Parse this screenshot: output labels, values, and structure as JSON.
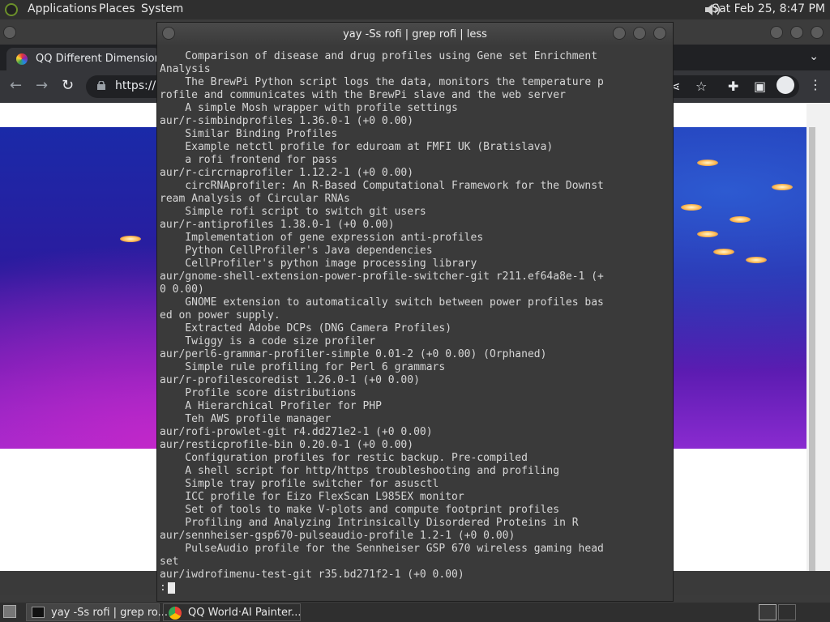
{
  "topbar": {
    "menus": [
      "Applications",
      "Places",
      "System"
    ],
    "clock": "Sat Feb 25,  8:47 PM"
  },
  "browser": {
    "tab_title": "QQ Different Dimension M",
    "url": "https://",
    "nav": {
      "back": "←",
      "forward": "→",
      "reload": "↻"
    },
    "icons": {
      "share": "⋖",
      "star": "☆",
      "extensions": "✚",
      "sidebar": "▣",
      "menu": "⋮",
      "tabs_dropdown": "⌄"
    }
  },
  "terminal": {
    "title": "yay -Ss rofi | grep rofi | less",
    "lines": [
      "    Comparison of disease and drug profiles using Gene set Enrichment",
      "Analysis",
      "    The BrewPi Python script logs the data, monitors the temperature p",
      "rofile and communicates with the BrewPi slave and the web server",
      "    A simple Mosh wrapper with profile settings",
      "aur/r-simbindprofiles 1.36.0-1 (+0 0.00)",
      "    Similar Binding Profiles",
      "    Example netctl profile for eduroam at FMFI UK (Bratislava)",
      "    a rofi frontend for pass",
      "aur/r-circrnaprofiler 1.12.2-1 (+0 0.00)",
      "    circRNAprofiler: An R-Based Computational Framework for the Downst",
      "ream Analysis of Circular RNAs",
      "    Simple rofi script to switch git users",
      "aur/r-antiprofiles 1.38.0-1 (+0 0.00)",
      "    Implementation of gene expression anti-profiles",
      "    Python CellProfiler's Java dependencies",
      "    CellProfiler's python image processing library",
      "aur/gnome-shell-extension-power-profile-switcher-git r211.ef64a8e-1 (+",
      "0 0.00)",
      "    GNOME extension to automatically switch between power profiles bas",
      "ed on power supply.",
      "    Extracted Adobe DCPs (DNG Camera Profiles)",
      "    Twiggy is a code size profiler",
      "aur/perl6-grammar-profiler-simple 0.01-2 (+0 0.00) (Orphaned)",
      "    Simple rule profiling for Perl 6 grammars",
      "aur/r-profilescoredist 1.26.0-1 (+0 0.00)",
      "    Profile score distributions",
      "    A Hierarchical Profiler for PHP",
      "    Teh AWS profile manager",
      "aur/rofi-prowlet-git r4.dd271e2-1 (+0 0.00)",
      "aur/resticprofile-bin 0.20.0-1 (+0 0.00)",
      "    Configuration profiles for restic backup. Pre-compiled",
      "    A shell script for http/https troubleshooting and profiling",
      "    Simple tray profile switcher for asusctl",
      "    ICC profile for Eizo FlexScan L985EX monitor",
      "    Set of tools to make V-plots and compute footprint profiles",
      "    Profiling and Analyzing Intrinsically Disordered Proteins in R",
      "aur/sennheiser-gsp670-pulseaudio-profile 1.2-1 (+0 0.00)",
      "    PulseAudio profile for the Sennheiser GSP 670 wireless gaming head",
      "set",
      "aur/iwdrofimenu-test-git r35.bd271f2-1 (+0 0.00)"
    ],
    "prompt": ":"
  },
  "taskbar": {
    "items": [
      "yay -Ss rofi | grep ro...",
      "QQ World·AI Painter..."
    ]
  }
}
